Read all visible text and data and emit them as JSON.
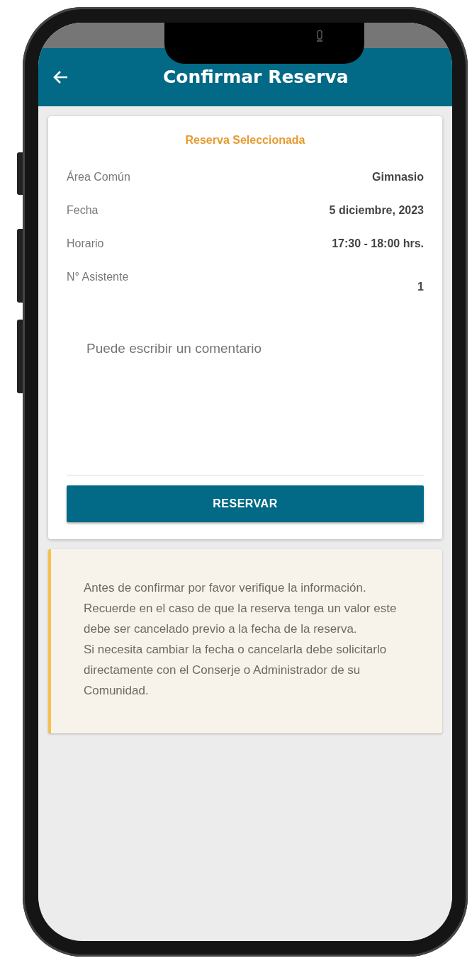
{
  "header": {
    "title": "Confirmar Reserva"
  },
  "reservation": {
    "title": "Reserva Seleccionada",
    "rows": [
      {
        "label": "Área Común",
        "value": "Gimnasio",
        "kind": "inline"
      },
      {
        "label": "Fecha",
        "value": "5 diciembre, 2023",
        "kind": "inline"
      },
      {
        "label": "Horario",
        "value": "17:30 - 18:00 hrs.",
        "kind": "inline"
      },
      {
        "label": "N° Asistente",
        "value": "1",
        "kind": "dropped"
      }
    ]
  },
  "comment": {
    "placeholder": "Puede escribir un comentario"
  },
  "submit_button": "RESERVAR",
  "notice": {
    "paragraphs": [
      "Antes de confirmar por favor verifique la información.",
      "Recuerde en el caso de que la reserva tenga un valor este debe ser cancelado previo a la fecha de la reserva.",
      "Si necesita cambiar la fecha o cancelarla debe solicitarlo directamente con el Conserje o Administrador de su Comunidad."
    ]
  }
}
